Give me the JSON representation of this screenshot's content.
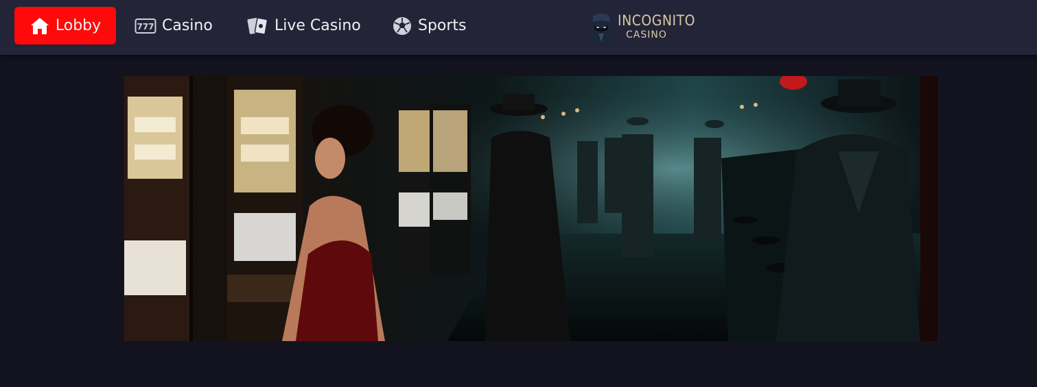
{
  "nav": {
    "items": [
      {
        "label": "Lobby",
        "icon": "home-icon",
        "active": true
      },
      {
        "label": "Casino",
        "icon": "slot-777-icon",
        "active": false
      },
      {
        "label": "Live Casino",
        "icon": "cards-icon",
        "active": false
      },
      {
        "label": "Sports",
        "icon": "soccer-ball-icon",
        "active": false
      }
    ]
  },
  "logo": {
    "line1": "INCOGNITO",
    "line2": "CASINO"
  },
  "colors": {
    "active": "#ff0a0a",
    "topbar": "#232437",
    "background": "#13131f",
    "logo_text": "#d9c9a3"
  }
}
